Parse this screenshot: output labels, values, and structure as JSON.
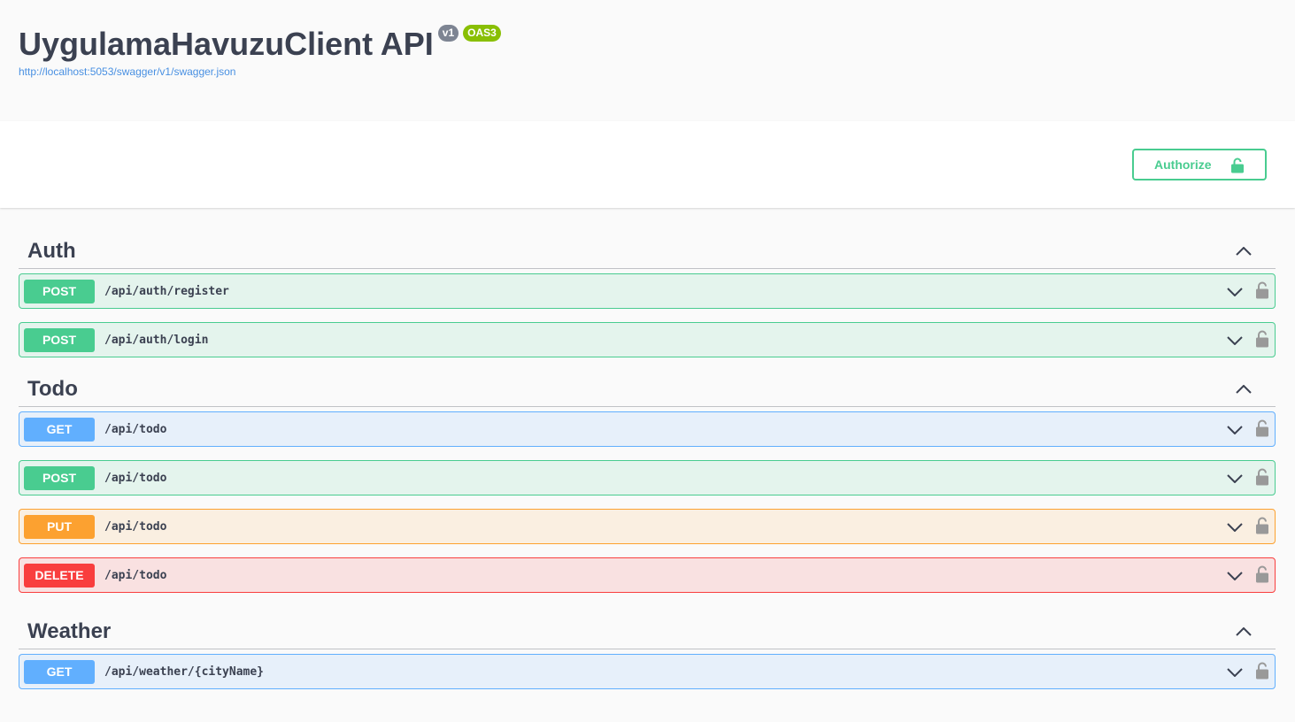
{
  "info": {
    "title": "UygulamaHavuzuClient API",
    "version_badge": "v1",
    "oas_badge": "OAS3",
    "spec_url": "http://localhost:5053/swagger/v1/swagger.json"
  },
  "authorize": {
    "label": "Authorize",
    "icon": "unlocked-padlock-icon"
  },
  "colors": {
    "post": "#49cc90",
    "get": "#61affe",
    "put": "#fca130",
    "delete": "#f93e3e"
  },
  "tags": [
    {
      "name": "Auth",
      "expanded": true,
      "operations": [
        {
          "method": "POST",
          "path": "/api/auth/register"
        },
        {
          "method": "POST",
          "path": "/api/auth/login"
        }
      ]
    },
    {
      "name": "Todo",
      "expanded": true,
      "operations": [
        {
          "method": "GET",
          "path": "/api/todo"
        },
        {
          "method": "POST",
          "path": "/api/todo"
        },
        {
          "method": "PUT",
          "path": "/api/todo"
        },
        {
          "method": "DELETE",
          "path": "/api/todo"
        }
      ]
    },
    {
      "name": "Weather",
      "expanded": true,
      "operations": [
        {
          "method": "GET",
          "path": "/api/weather/{cityName}"
        }
      ]
    }
  ]
}
